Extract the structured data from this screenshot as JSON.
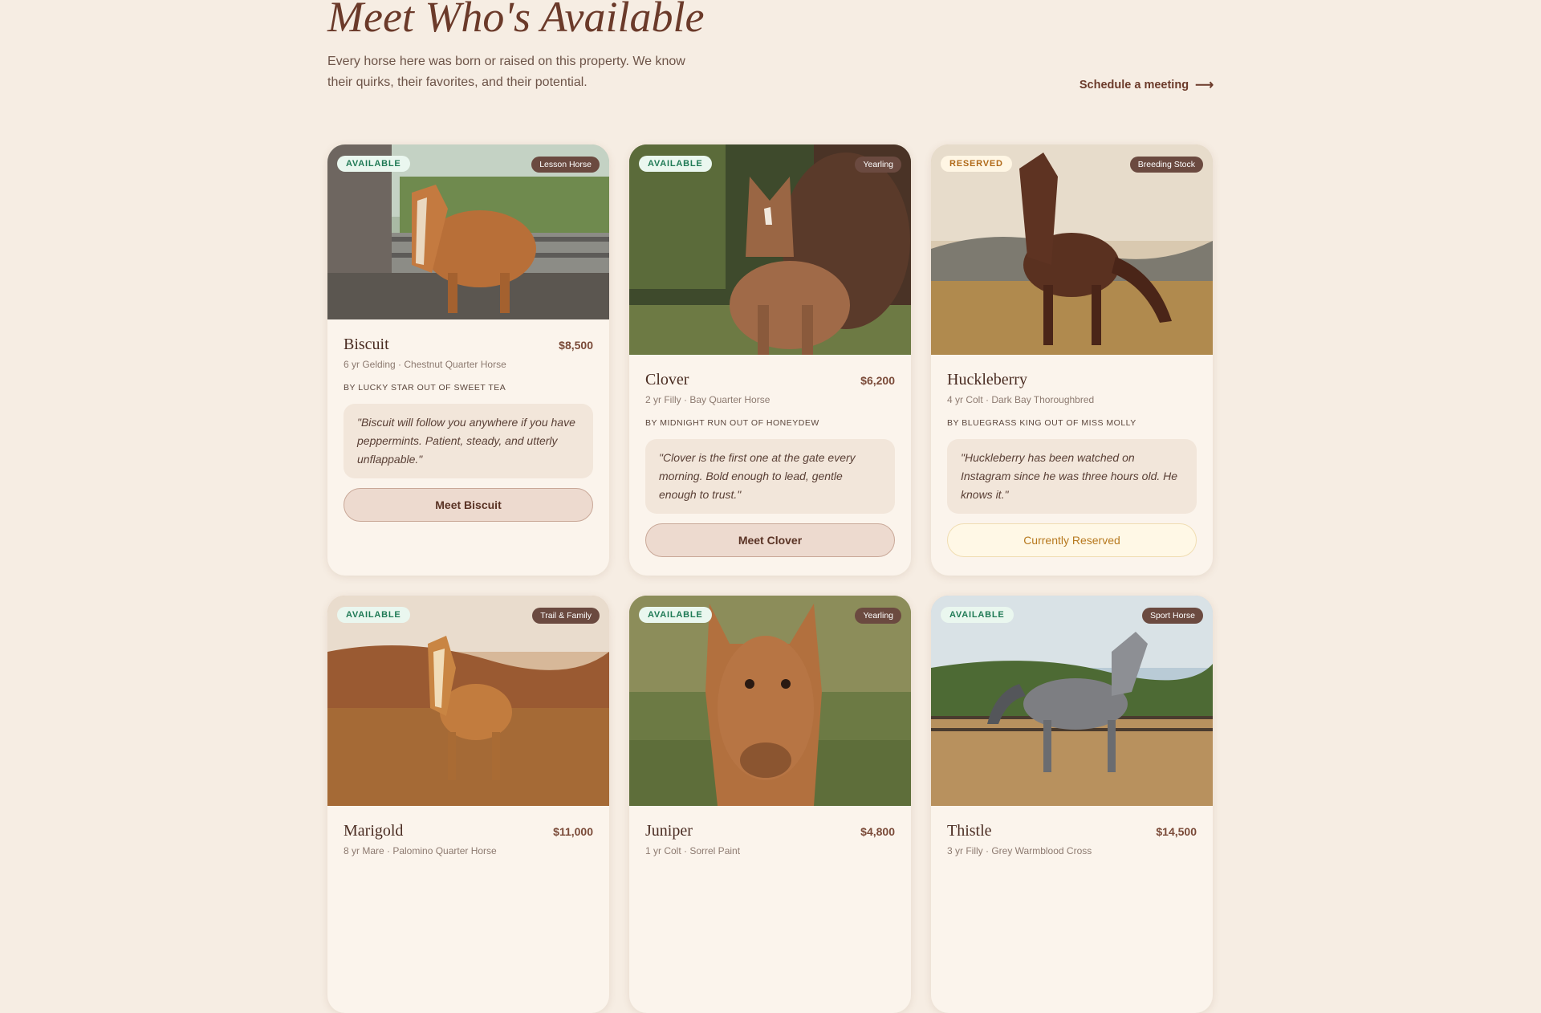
{
  "header": {
    "title": "Meet Who's Available",
    "subtitle": "Every horse here was born or raised on this property. We know their quirks, their favorites, and their potential.",
    "schedule_label": "Schedule a meeting",
    "schedule_icon": "arrow-right-icon"
  },
  "colors": {
    "background": "#f6ede3",
    "accent": "#6b3a2a",
    "available": "#1f7a55",
    "reserved": "#b06a1a"
  },
  "horses": [
    {
      "status": "AVAILABLE",
      "category": "Lesson Horse",
      "name": "Biscuit",
      "price": "$8,500",
      "meta": "6 yr Gelding · Chestnut Quarter Horse",
      "pedigree": "BY LUCKY STAR OUT OF SWEET TEA",
      "quote": "\"Biscuit will follow you anywhere if you have peppermints. Patient, steady, and utterly unflappable.\"",
      "button": "Meet Biscuit"
    },
    {
      "status": "AVAILABLE",
      "category": "Yearling",
      "name": "Clover",
      "price": "$6,200",
      "meta": "2 yr Filly · Bay Quarter Horse",
      "pedigree": "BY MIDNIGHT RUN OUT OF HONEYDEW",
      "quote": "\"Clover is the first one at the gate every morning. Bold enough to lead, gentle enough to trust.\"",
      "button": "Meet Clover"
    },
    {
      "status": "RESERVED",
      "category": "Breeding Stock",
      "name": "Huckleberry",
      "price": "",
      "meta": "4 yr Colt · Dark Bay Thoroughbred",
      "pedigree": "BY BLUEGRASS KING OUT OF MISS MOLLY",
      "quote": "\"Huckleberry has been watched on Instagram since he was three hours old. He knows it.\"",
      "button": "Currently Reserved"
    },
    {
      "status": "AVAILABLE",
      "category": "Trail & Family",
      "name": "Marigold",
      "price": "$11,000",
      "meta": "8 yr Mare · Palomino Quarter Horse"
    },
    {
      "status": "AVAILABLE",
      "category": "Yearling",
      "name": "Juniper",
      "price": "$4,800",
      "meta": "1 yr Colt · Sorrel Paint"
    },
    {
      "status": "AVAILABLE",
      "category": "Sport Horse",
      "name": "Thistle",
      "price": "$14,500",
      "meta": "3 yr Filly · Grey Warmblood Cross"
    }
  ]
}
